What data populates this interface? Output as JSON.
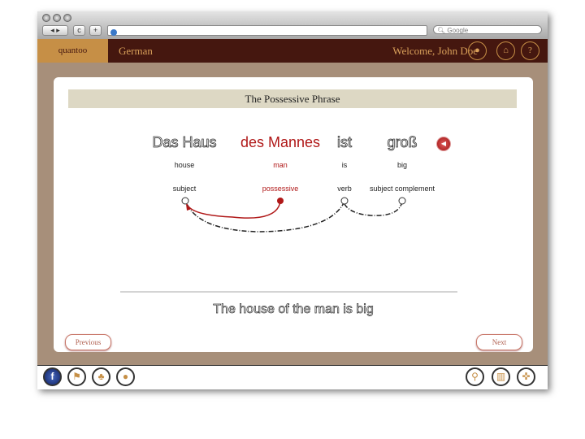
{
  "browser": {
    "search_placeholder": "Google"
  },
  "header": {
    "logo": "quantoo",
    "language": "German",
    "welcome": "Welcome, John Doe"
  },
  "lesson": {
    "title": "The Possessive Phrase",
    "words": [
      {
        "de": "Das Haus",
        "en": "house",
        "role": "subject"
      },
      {
        "de": "des Mannes",
        "en": "man",
        "role": "possessive"
      },
      {
        "de": "ist",
        "en": "is",
        "role": "verb"
      },
      {
        "de": "groß",
        "en": "big",
        "role": "subject complement"
      }
    ],
    "translation": "The house of the man is big",
    "previous": "Previous",
    "next": "Next"
  },
  "colors": {
    "accent": "#b01818",
    "header": "#45170f",
    "brand": "#c68f46"
  }
}
